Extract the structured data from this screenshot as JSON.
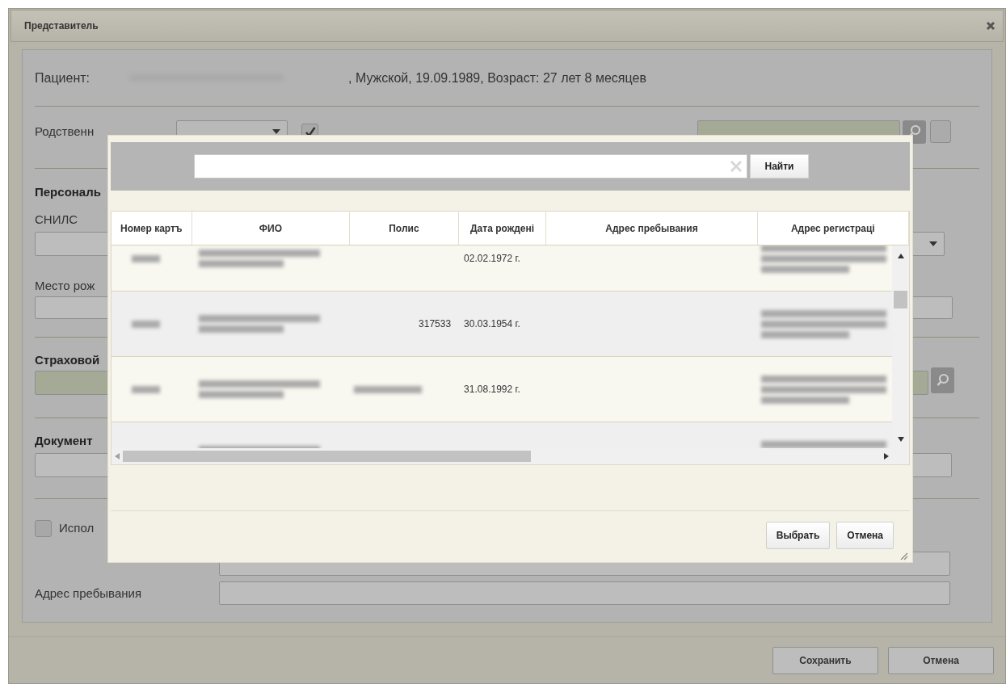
{
  "window": {
    "title": "Представитель"
  },
  "patient": {
    "label": "Пациент:",
    "name_redacted": true,
    "details": ", Мужской, 19.09.1989, Возраст: 27 лет 8 месяцев"
  },
  "relation": {
    "label": "Родственн",
    "legal_representative_checked": true
  },
  "sections": [
    {
      "kind": "snils",
      "heading": "Персональ",
      "label": "СНИЛС"
    },
    {
      "kind": "birthplace",
      "label": "Место рож"
    },
    {
      "kind": "insurance",
      "heading": "Страховой"
    },
    {
      "kind": "document",
      "heading": "Документ"
    }
  ],
  "use_address": {
    "label": "Испол",
    "checked": false
  },
  "addresses": [
    {
      "kind": "unlabeled"
    },
    {
      "kind": "labeled",
      "label": "Адрес пребывания"
    }
  ],
  "search_dialog": {
    "search_button": "Найти",
    "columns": [
      "Номер картъ",
      "ФИО",
      "Полис",
      "Дата рождені",
      "Адрес пребывания",
      "Адрес регистраці"
    ],
    "rows": [
      {
        "card_redacted": true,
        "name_redacted": true,
        "dob": "02.02.1972 г.",
        "reg_redacted": true
      },
      {
        "card_redacted": true,
        "name_redacted": true,
        "policy": "317533",
        "dob": "30.03.1954 г.",
        "reg_redacted": true
      },
      {
        "card_redacted": true,
        "name_redacted": true,
        "policy_redacted": true,
        "dob": "31.08.1992 г.",
        "reg_redacted": true
      },
      {
        "name_redacted": true,
        "reg_redacted": true
      }
    ],
    "buttons": [
      "Выбрать",
      "Отмена"
    ]
  },
  "footer_buttons": [
    "Сохранить",
    "Отмена"
  ]
}
